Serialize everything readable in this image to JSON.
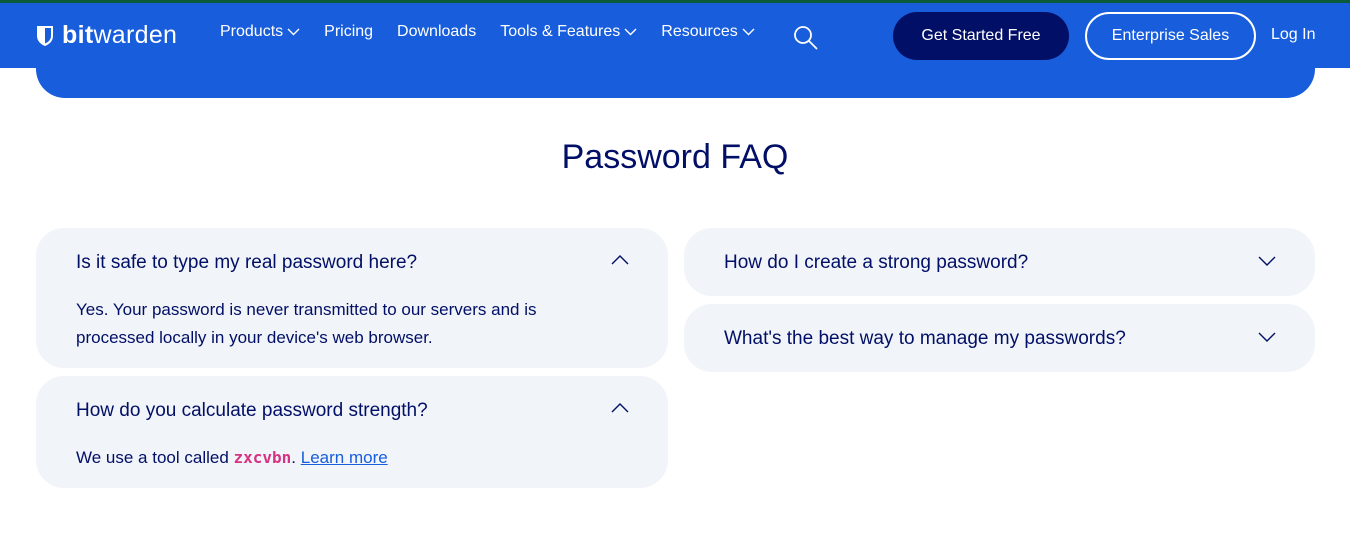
{
  "brand": {
    "bold": "bit",
    "rest": "warden"
  },
  "nav": {
    "items": [
      {
        "label": "Products",
        "dropdown": true
      },
      {
        "label": "Pricing",
        "dropdown": false
      },
      {
        "label": "Downloads",
        "dropdown": false
      },
      {
        "label": "Tools & Features",
        "dropdown": true
      },
      {
        "label": "Resources",
        "dropdown": true
      }
    ],
    "get_started": "Get Started Free",
    "enterprise": "Enterprise Sales",
    "login": "Log In"
  },
  "faq": {
    "title": "Password FAQ",
    "left": [
      {
        "question": "Is it safe to type my real password here?",
        "expanded": true,
        "answer": "Yes. Your password is never transmitted to our servers and is processed locally in your device's web browser."
      },
      {
        "question": "How do you calculate password strength?",
        "expanded": true,
        "answer_prefix": "We use a tool called ",
        "answer_code": "zxcvbn",
        "answer_period": ".",
        "answer_link": "Learn more"
      }
    ],
    "right": [
      {
        "question": "How do I create a strong password?",
        "expanded": false
      },
      {
        "question": "What's the best way to manage my passwords?",
        "expanded": false
      }
    ]
  },
  "colors": {
    "brand_blue": "#175ddc",
    "navy": "#020f66",
    "card_bg": "#f1f4f8",
    "code_pink": "#d63384"
  },
  "icons": {
    "logo": "bitwarden-shield-icon",
    "search": "search-icon",
    "expand": "chevron-down-icon",
    "collapse": "chevron-up-icon"
  }
}
